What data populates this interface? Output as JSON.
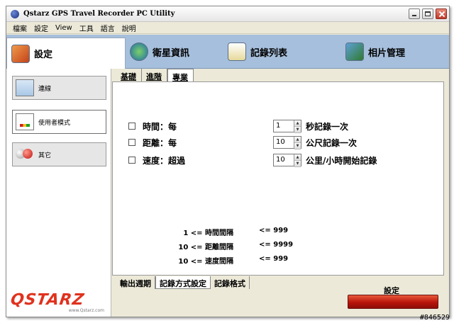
{
  "window": {
    "title": "Qstarz GPS Travel Recorder PC Utility"
  },
  "menu": {
    "items": [
      "檔案",
      "設定",
      "View",
      "工具",
      "語言",
      "說明"
    ]
  },
  "toolbar": {
    "items": [
      {
        "label": "設定",
        "icon": "settings-icon"
      },
      {
        "label": "衛星資訊",
        "icon": "satellite-icon"
      },
      {
        "label": "記錄列表",
        "icon": "log-list-icon"
      },
      {
        "label": "相片管理",
        "icon": "photo-icon"
      }
    ]
  },
  "sidebar": {
    "items": [
      {
        "label": "連線",
        "icon": "connection-icon"
      },
      {
        "label": "使用者模式",
        "icon": "user-mode-icon"
      },
      {
        "label": "其它",
        "icon": "other-icon"
      }
    ],
    "logo": {
      "text": "QSTARZ",
      "subtitle": "www.Qstarz.com"
    }
  },
  "tabs_top": [
    "基礎",
    "進階",
    "專業"
  ],
  "log_settings": [
    {
      "label": "時間：每",
      "value": "1",
      "suffix": "秒記錄一次",
      "checked": false
    },
    {
      "label": "距離：每",
      "value": "10",
      "suffix": "公尺記錄一次",
      "checked": false
    },
    {
      "label": "速度：超過",
      "value": "10",
      "suffix": "公里/小時開始記錄",
      "checked": false
    }
  ],
  "ranges": [
    {
      "left": "1 <= 時間間隔",
      "right": "<= 999"
    },
    {
      "left": "10 <= 距離間隔",
      "right": "<= 9999"
    },
    {
      "left": "10 <= 速度間隔",
      "right": "<= 999"
    }
  ],
  "tabs_bottom": [
    "輸出週期",
    "記錄方式設定",
    "記錄格式"
  ],
  "apply": {
    "label": "設定"
  },
  "watermark": "#846529",
  "colors": {
    "toolbar_bg": "#a6bfdc",
    "logo_red": "#e0321e",
    "apply_button": "#b8140a"
  }
}
